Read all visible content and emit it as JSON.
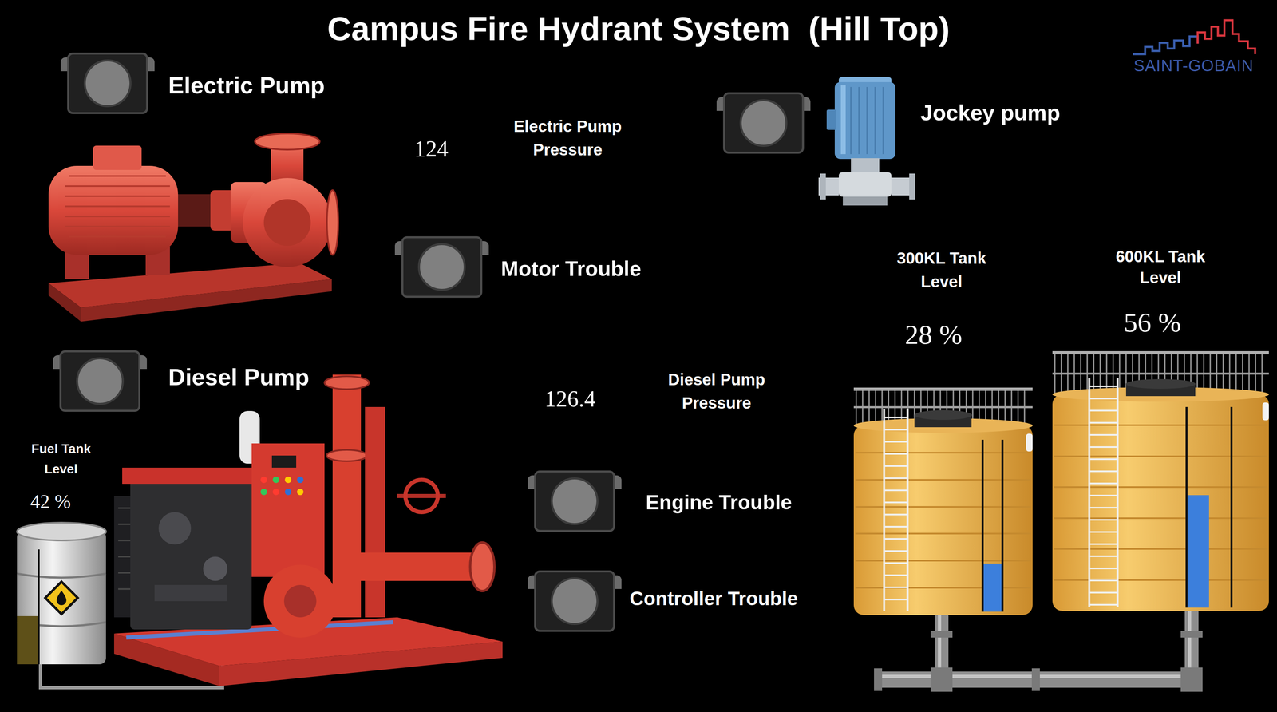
{
  "title": "Campus Fire Hydrant System  (Hill Top)",
  "logo": {
    "text": "SAINT-GOBAIN"
  },
  "indicators": [
    {
      "label": "Electric Pump",
      "on": false
    },
    {
      "label": "Motor Trouble",
      "on": false
    },
    {
      "label": "Jockey pump",
      "on": false
    },
    {
      "label": "Diesel Pump",
      "on": false
    },
    {
      "label": "Engine Trouble",
      "on": false
    },
    {
      "label": "Controller Trouble",
      "on": false
    }
  ],
  "pressures": [
    {
      "label_lines": [
        "Electric Pump",
        "Pressure"
      ],
      "value": "124"
    },
    {
      "label_lines": [
        "Diesel Pump",
        "Pressure"
      ],
      "value": "126.4"
    }
  ],
  "fuel_tank": {
    "label_lines": [
      "Fuel Tank",
      "Level"
    ],
    "reading": "42 %",
    "level": 0.42
  },
  "water_tanks": [
    {
      "label_lines": [
        "300KL Tank",
        "Level"
      ],
      "reading": "28 %",
      "level": 0.28
    },
    {
      "label_lines": [
        "600KL Tank",
        "Level"
      ],
      "reading": "56 %",
      "level": 0.56
    }
  ]
}
